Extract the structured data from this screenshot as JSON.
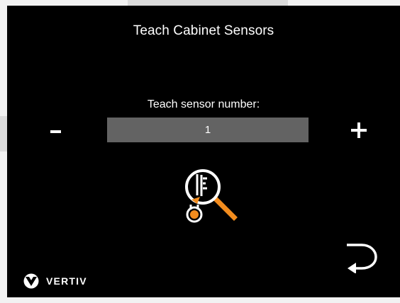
{
  "screen": {
    "title": "Teach Cabinet Sensors",
    "field_label": "Teach sensor number:",
    "sensor_number": "1",
    "decrement_label": "-",
    "increment_label": "+",
    "back_icon": "return-arrow-icon",
    "sensor_icon": "sensor-search-icon",
    "accent_color": "#f28c1e"
  },
  "branding": {
    "logo_text": "VERTIV",
    "logo_icon": "vertiv-logo-icon"
  }
}
